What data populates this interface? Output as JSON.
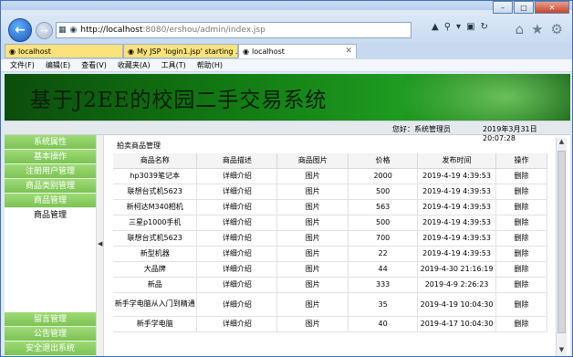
{
  "browser": {
    "url_host": "http://localhost",
    "url_rest": ":8080/ershou/admin/index.jsp",
    "tabs": [
      {
        "label": "localhost"
      },
      {
        "label": "My JSP 'login1.jsp' starting ..."
      },
      {
        "label": "localhost"
      }
    ],
    "menu": [
      "文件(F)",
      "编辑(E)",
      "查看(V)",
      "收藏夹(A)",
      "工具(T)",
      "帮助(H)"
    ]
  },
  "header": {
    "title": "基于J2EE的校园二手交易系统",
    "greeting": "您好：系统管理员",
    "datetime": "2019年3月31日　20:07:28"
  },
  "sidebar": {
    "items": [
      "系统属性",
      "基本操作",
      "注册用户管理",
      "商品类别管理",
      "商品管理"
    ],
    "sub_item": "商品管理",
    "bottom_items": [
      "留言管理",
      "公告管理",
      "安全退出系统"
    ]
  },
  "main": {
    "section_title": "拍卖商品管理",
    "columns": [
      "商品名称",
      "商品描述",
      "商品图片",
      "价格",
      "发布时间",
      "操作"
    ],
    "rows": [
      {
        "name": "hp3039笔记本",
        "desc": "详细介绍",
        "img": "图片",
        "price": "2000",
        "time": "2019-4-19 4:39:53",
        "op": "删除"
      },
      {
        "name": "联想台式机5623",
        "desc": "详细介绍",
        "img": "图片",
        "price": "500",
        "time": "2019-4-19 4:39:53",
        "op": "删除"
      },
      {
        "name": "新柯达M340相机",
        "desc": "详细介绍",
        "img": "图片",
        "price": "563",
        "time": "2019-4-19 4:39:53",
        "op": "删除"
      },
      {
        "name": "三星p1000手机",
        "desc": "详细介绍",
        "img": "图片",
        "price": "500",
        "time": "2019-4-19 4:39:53",
        "op": "删除"
      },
      {
        "name": "联想台式机5623",
        "desc": "详细介绍",
        "img": "图片",
        "price": "700",
        "time": "2019-4-19 4:39:53",
        "op": "删除"
      },
      {
        "name": "新型机器",
        "desc": "详细介绍",
        "img": "图片",
        "price": "22",
        "time": "2019-4-19 4:39:53",
        "op": "删除"
      },
      {
        "name": "大品牌",
        "desc": "详细介绍",
        "img": "图片",
        "price": "44",
        "time": "2019-4-30 21:16:19",
        "op": "删除"
      },
      {
        "name": "新品",
        "desc": "详细介绍",
        "img": "图片",
        "price": "333",
        "time": "2019-4-9 2:26:23",
        "op": "删除"
      },
      {
        "name": "新手学电脑从入门到精通",
        "desc": "详细介绍",
        "img": "图片",
        "price": "35",
        "time": "2019-4-19 10:04:30",
        "op": "删除"
      },
      {
        "name": "新手学电脑",
        "desc": "详细介绍",
        "img": "图片",
        "price": "40",
        "time": "2019-4-17 10:04:30",
        "op": "删除"
      }
    ]
  }
}
